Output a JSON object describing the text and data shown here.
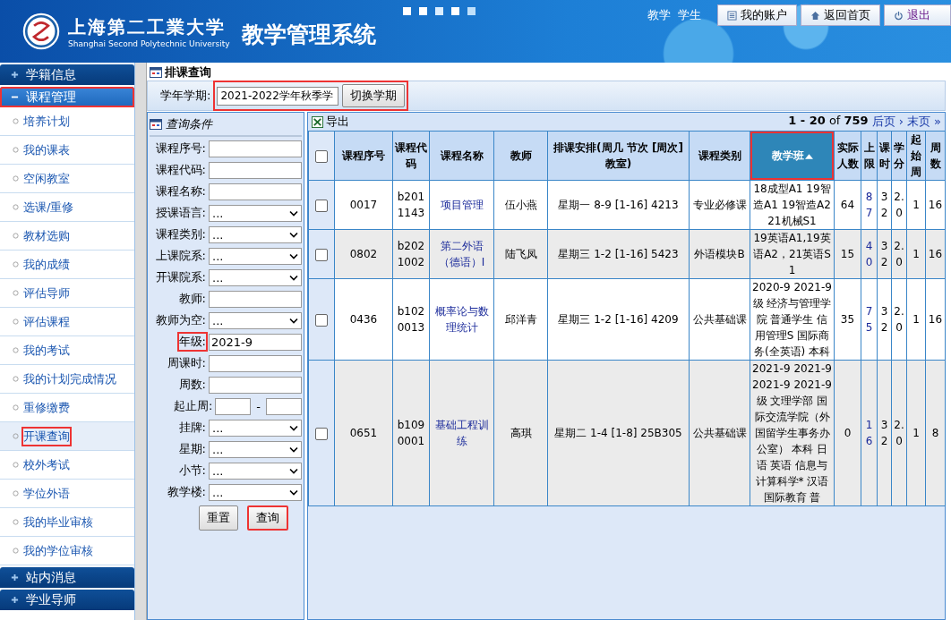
{
  "header": {
    "school_name": "上海第二工業大学",
    "school_name_en": "Shanghai Second Polytechnic University",
    "system_name": "教学管理系统",
    "user": "教学  学生",
    "buttons": [
      {
        "label": "我的账户",
        "kind": "account"
      },
      {
        "label": "返回首页",
        "kind": "home"
      },
      {
        "label": "退出",
        "kind": "logout"
      }
    ]
  },
  "sidebar": [
    {
      "label": "学籍信息",
      "expanded": false,
      "highlighted": false
    },
    {
      "label": "课程管理",
      "expanded": true,
      "highlighted": true,
      "children": [
        {
          "label": "培养计划",
          "selected": false,
          "highlighted": false
        },
        {
          "label": "我的课表",
          "selected": false,
          "highlighted": false
        },
        {
          "label": "空闲教室",
          "selected": false,
          "highlighted": false
        },
        {
          "label": "选课/重修",
          "selected": false,
          "highlighted": false
        },
        {
          "label": "教材选购",
          "selected": false,
          "highlighted": false
        },
        {
          "label": "我的成绩",
          "selected": false,
          "highlighted": false
        },
        {
          "label": "评估导师",
          "selected": false,
          "highlighted": false
        },
        {
          "label": "评估课程",
          "selected": false,
          "highlighted": false
        },
        {
          "label": "我的考试",
          "selected": false,
          "highlighted": false
        },
        {
          "label": "我的计划完成情况",
          "selected": false,
          "highlighted": false
        },
        {
          "label": "重修缴费",
          "selected": false,
          "highlighted": false
        },
        {
          "label": "开课查询",
          "selected": true,
          "highlighted": true
        },
        {
          "label": "校外考试",
          "selected": false,
          "highlighted": false
        },
        {
          "label": "学位外语",
          "selected": false,
          "highlighted": false
        },
        {
          "label": "我的毕业审核",
          "selected": false,
          "highlighted": false
        },
        {
          "label": "我的学位审核",
          "selected": false,
          "highlighted": false
        }
      ]
    },
    {
      "label": "站内消息",
      "expanded": false,
      "highlighted": false
    },
    {
      "label": "学业导师",
      "expanded": false,
      "highlighted": false
    }
  ],
  "page": {
    "title": "排课查询",
    "semester": {
      "label": "学年学期:",
      "value": "2021-2022学年秋季学",
      "button": "切换学期",
      "highlighted": true
    }
  },
  "query": {
    "title": "查询条件",
    "fields": [
      {
        "label": "课程序号:",
        "kind": "text",
        "highlighted": false
      },
      {
        "label": "课程代码:",
        "kind": "text",
        "highlighted": false
      },
      {
        "label": "课程名称:",
        "kind": "text",
        "highlighted": false
      },
      {
        "label": "授课语言:",
        "kind": "select",
        "value": "...",
        "highlighted": false
      },
      {
        "label": "课程类别:",
        "kind": "select",
        "value": "...",
        "highlighted": false
      },
      {
        "label": "上课院系:",
        "kind": "select",
        "value": "...",
        "highlighted": false
      },
      {
        "label": "开课院系:",
        "kind": "select",
        "value": "...",
        "highlighted": false
      },
      {
        "label": "教师:",
        "kind": "text",
        "highlighted": false
      },
      {
        "label": "教师为空:",
        "kind": "select",
        "value": "...",
        "highlighted": false
      },
      {
        "label": "年级:",
        "kind": "text",
        "value": "2021-9",
        "highlighted": true
      },
      {
        "label": "周课时:",
        "kind": "text",
        "highlighted": false
      },
      {
        "label": "周数:",
        "kind": "text",
        "highlighted": false
      },
      {
        "label": "起止周:",
        "kind": "range",
        "separator": "-",
        "highlighted": false
      },
      {
        "label": "挂牌:",
        "kind": "select",
        "value": "...",
        "highlighted": false
      },
      {
        "label": "星期:",
        "kind": "select",
        "value": "...",
        "highlighted": false
      },
      {
        "label": "小节:",
        "kind": "select",
        "value": "...",
        "highlighted": false
      },
      {
        "label": "教学楼:",
        "kind": "select",
        "value": "...",
        "highlighted": false
      }
    ],
    "buttons": [
      {
        "label": "重置",
        "highlighted": false
      },
      {
        "label": "查询",
        "highlighted": true
      }
    ]
  },
  "table": {
    "export": "导出",
    "pagination": {
      "range": "1 - 20",
      "of": "of",
      "total": "759",
      "next": "后页 ›",
      "last": "末页 »"
    },
    "header_checkbox": {
      "checked": false
    },
    "columns": [
      {
        "label": "课程序号",
        "kind": "text",
        "sorted": false,
        "highlighted": false
      },
      {
        "label": "课程代码",
        "kind": "text",
        "sorted": false,
        "highlighted": false
      },
      {
        "label": "课程名称",
        "kind": "link",
        "sorted": false,
        "highlighted": false
      },
      {
        "label": "教师",
        "kind": "text",
        "sorted": false,
        "highlighted": false
      },
      {
        "label": "排课安排(周几 节次 [周次] 教室)",
        "kind": "text",
        "sorted": false,
        "highlighted": false
      },
      {
        "label": "课程类别",
        "kind": "text",
        "sorted": false,
        "highlighted": false
      },
      {
        "label": "教学班",
        "kind": "text",
        "sorted": true,
        "highlighted": true
      },
      {
        "label": "实际人数",
        "kind": "text",
        "sorted": false,
        "highlighted": false
      },
      {
        "label": "上限",
        "kind": "link",
        "sorted": false,
        "highlighted": false
      },
      {
        "label": "课时",
        "kind": "text",
        "sorted": false,
        "highlighted": false
      },
      {
        "label": "学分",
        "kind": "text",
        "sorted": false,
        "highlighted": false
      },
      {
        "label": "起始周",
        "kind": "text",
        "sorted": false,
        "highlighted": false
      },
      {
        "label": "周数",
        "kind": "text",
        "sorted": false,
        "highlighted": false
      }
    ],
    "rows": [
      {
        "checked": false,
        "cells": [
          "0017",
          "b2011143",
          "项目管理",
          "伍小燕",
          "星期一 8-9 [1-16] 4213",
          "专业必修课",
          "18成型A1 19智造A1 19智造A2 21机械S1",
          "64",
          "87",
          "32",
          "2.0",
          "1",
          "16"
        ]
      },
      {
        "checked": false,
        "cells": [
          "0802",
          "b2021002",
          "第二外语（德语）I",
          "陆飞凤",
          "星期三 1-2 [1-16] 5423",
          "外语模块B",
          "19英语A1,19英语A2，21英语S1",
          "15",
          "40",
          "32",
          "2.0",
          "1",
          "16"
        ]
      },
      {
        "checked": false,
        "cells": [
          "0436",
          "b1020013",
          "概率论与数理统计",
          "邱洋青",
          "星期三 1-2 [1-16] 4209",
          "公共基础课",
          "2020-9 2021-9级 经济与管理学院 普通学生 信用管理S 国际商务(全英语) 本科",
          "35",
          "75",
          "32",
          "2.0",
          "1",
          "16"
        ]
      },
      {
        "checked": false,
        "cells": [
          "0651",
          "b1090001",
          "基础工程训练",
          "高琪",
          "星期二 1-4 [1-8] 25B305",
          "公共基础课",
          "2021-9 2021-9 2021-9 2021-9级 文理学部 国际交流学院（外国留学生事务办公室） 本科 日语 英语 信息与计算科学* 汉语国际教育 普",
          "0",
          "16",
          "32",
          "2.0",
          "1",
          "8"
        ]
      }
    ]
  }
}
